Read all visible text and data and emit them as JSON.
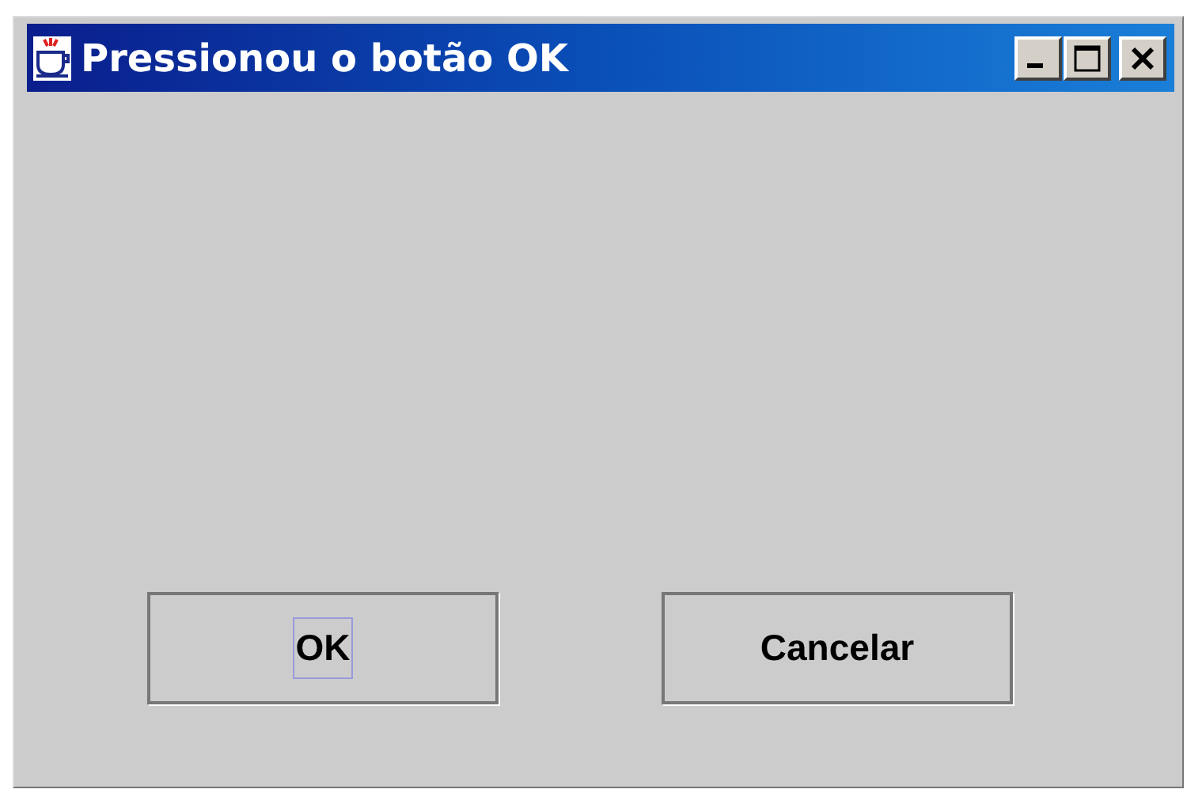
{
  "window": {
    "title": "Pressionou o botão OK"
  },
  "buttons": [
    {
      "label": "OK",
      "focused": true
    },
    {
      "label": "Cancelar",
      "focused": false
    }
  ]
}
